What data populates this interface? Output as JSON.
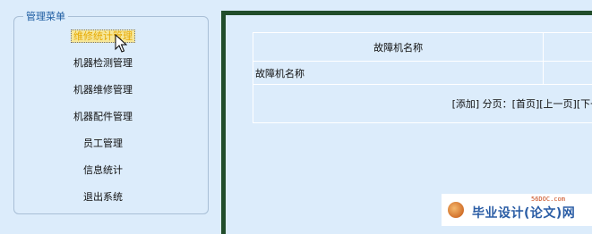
{
  "menu": {
    "legend": "管理菜单",
    "items": [
      {
        "label": "维修统计管理",
        "active": true
      },
      {
        "label": "机器检测管理"
      },
      {
        "label": "机器维修管理"
      },
      {
        "label": "机器配件管理"
      },
      {
        "label": "员工管理"
      },
      {
        "label": "信息统计"
      },
      {
        "label": "退出系统"
      }
    ]
  },
  "table": {
    "header": "故障机名称",
    "row_cell": "故障机名称",
    "pager": "[添加]  分页：[首页][上一页][下一页][尾页]"
  },
  "watermark": {
    "url": "56DOC.com",
    "text": "毕业设计(论文)网"
  },
  "colors": {
    "background": "#dcecfb",
    "frame_border": "#214d2a",
    "legend_text": "#1a5aa0"
  }
}
